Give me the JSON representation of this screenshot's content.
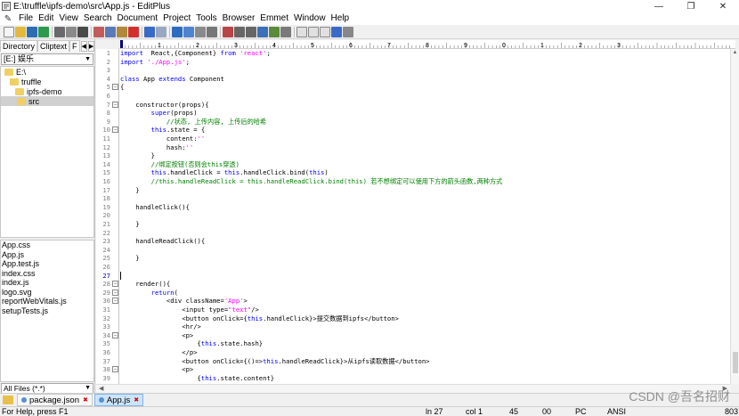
{
  "window": {
    "title": "E:\\truffle\\ipfs-demo\\src\\App.js - EditPlus",
    "controls": {
      "minimize": "—",
      "maximize": "❐",
      "close": "✕"
    }
  },
  "menu": [
    "File",
    "Edit",
    "View",
    "Search",
    "Document",
    "Project",
    "Tools",
    "Browser",
    "Emmet",
    "Window",
    "Help"
  ],
  "left_panel": {
    "tabs": [
      "Directory",
      "Cliptext",
      "F"
    ],
    "drive": "[E:] 娱乐",
    "tree": [
      {
        "label": "E:\\",
        "depth": 0
      },
      {
        "label": "truffle",
        "depth": 1
      },
      {
        "label": "ipfs-demo",
        "depth": 2
      },
      {
        "label": "src",
        "depth": 3,
        "selected": true
      }
    ],
    "files": [
      "App.css",
      "App.js",
      "App.test.js",
      "index.css",
      "index.js",
      "logo.svg",
      "reportWebVitals.js",
      "setupTests.js"
    ],
    "filter": "All Files (*.*)"
  },
  "ruler_labels": [
    "1",
    "2",
    "3",
    "4",
    "5",
    "6",
    "7",
    "8",
    "9",
    "0",
    "1",
    "2",
    "3"
  ],
  "editor": {
    "current_line": 27,
    "lines": [
      {
        "n": "1",
        "code": [
          [
            "kw",
            "import"
          ],
          [
            "",
            "  React,{Component} "
          ],
          [
            "kw",
            "from"
          ],
          [
            "",
            " "
          ],
          [
            "str",
            "'react'"
          ],
          [
            "",
            ";"
          ]
        ]
      },
      {
        "n": "2",
        "code": [
          [
            "kw",
            "import"
          ],
          [
            "",
            " "
          ],
          [
            "str",
            "'./App.js'"
          ],
          [
            "",
            ";"
          ]
        ]
      },
      {
        "n": "3",
        "code": []
      },
      {
        "n": "4",
        "code": [
          [
            "kw",
            "class"
          ],
          [
            "",
            " App "
          ],
          [
            "kw",
            "extends"
          ],
          [
            "",
            " Component"
          ]
        ]
      },
      {
        "n": "5",
        "fold": true,
        "code": [
          [
            "",
            "{"
          ]
        ]
      },
      {
        "n": "6",
        "code": []
      },
      {
        "n": "7",
        "fold": true,
        "code": [
          [
            "",
            "    constructor(props){"
          ]
        ]
      },
      {
        "n": "8",
        "code": [
          [
            "",
            "        "
          ],
          [
            "kw",
            "super"
          ],
          [
            "",
            "(props)"
          ]
        ]
      },
      {
        "n": "9",
        "code": [
          [
            "cmt",
            "            //状态, 上传内容, 上传后的哈希"
          ]
        ]
      },
      {
        "n": "10",
        "fold": true,
        "code": [
          [
            "",
            "        "
          ],
          [
            "kw",
            "this"
          ],
          [
            "",
            ".state = {"
          ]
        ]
      },
      {
        "n": "11",
        "code": [
          [
            "",
            "            content:"
          ],
          [
            "str",
            "''"
          ]
        ]
      },
      {
        "n": "12",
        "code": [
          [
            "",
            "            hash:"
          ],
          [
            "str",
            "''"
          ]
        ]
      },
      {
        "n": "13",
        "code": [
          [
            "",
            "        }"
          ]
        ]
      },
      {
        "n": "14",
        "code": [
          [
            "cmt",
            "        //绑定按钮(否则会this穿透)"
          ]
        ]
      },
      {
        "n": "15",
        "code": [
          [
            "",
            "        "
          ],
          [
            "kw",
            "this"
          ],
          [
            "",
            ".handleClick = "
          ],
          [
            "kw",
            "this"
          ],
          [
            "",
            ".handleClick.bind("
          ],
          [
            "kw",
            "this"
          ],
          [
            "",
            ")"
          ]
        ]
      },
      {
        "n": "16",
        "code": [
          [
            "cmt",
            "        //this.handleReadClick = this.handleReadClick.bind(this) 若不想绑定可以使用下方的箭头函数,两种方式"
          ]
        ]
      },
      {
        "n": "17",
        "code": [
          [
            "",
            "    }"
          ]
        ]
      },
      {
        "n": "18",
        "code": []
      },
      {
        "n": "19",
        "code": [
          [
            "",
            "    handleClick(){"
          ]
        ]
      },
      {
        "n": "20",
        "code": []
      },
      {
        "n": "21",
        "code": [
          [
            "",
            "    }"
          ]
        ]
      },
      {
        "n": "22",
        "code": []
      },
      {
        "n": "23",
        "code": [
          [
            "",
            "    handleReadClick(){"
          ]
        ]
      },
      {
        "n": "24",
        "code": []
      },
      {
        "n": "25",
        "code": [
          [
            "",
            "    }"
          ]
        ]
      },
      {
        "n": "26",
        "code": []
      },
      {
        "n": "27",
        "code": []
      },
      {
        "n": "28",
        "fold": true,
        "code": [
          [
            "",
            "    render(){"
          ]
        ]
      },
      {
        "n": "29",
        "fold": true,
        "code": [
          [
            "",
            "        "
          ],
          [
            "kw",
            "return"
          ],
          [
            "",
            "("
          ]
        ]
      },
      {
        "n": "30",
        "fold": true,
        "code": [
          [
            "",
            "            <div className="
          ],
          [
            "str",
            "'App'"
          ],
          [
            "",
            ">"
          ]
        ]
      },
      {
        "n": "31",
        "code": [
          [
            "",
            "                <input type="
          ],
          [
            "str",
            "\"text\""
          ],
          [
            "",
            "/>"
          ]
        ]
      },
      {
        "n": "32",
        "code": [
          [
            "",
            "                <button onClick={"
          ],
          [
            "kw",
            "this"
          ],
          [
            "",
            ".handleClick}>提交数据到ipfs</button>"
          ]
        ]
      },
      {
        "n": "33",
        "code": [
          [
            "",
            "                <hr/>"
          ]
        ]
      },
      {
        "n": "34",
        "fold": true,
        "code": [
          [
            "",
            "                <p>"
          ]
        ]
      },
      {
        "n": "35",
        "code": [
          [
            "",
            "                    {"
          ],
          [
            "kw",
            "this"
          ],
          [
            "",
            ".state.hash}"
          ]
        ]
      },
      {
        "n": "36",
        "code": [
          [
            "",
            "                </p>"
          ]
        ]
      },
      {
        "n": "37",
        "code": [
          [
            "",
            "                <button onClick={()=>"
          ],
          [
            "kw",
            "this"
          ],
          [
            "",
            ".handleReadClick}>从ipfs读取数据</button>"
          ]
        ]
      },
      {
        "n": "38",
        "fold": true,
        "code": [
          [
            "",
            "                <p>"
          ]
        ]
      },
      {
        "n": "39",
        "code": [
          [
            "",
            "                    {"
          ],
          [
            "kw",
            "this"
          ],
          [
            "",
            ".state.content}"
          ]
        ]
      }
    ]
  },
  "doc_tabs": [
    {
      "label": "package.json",
      "close": "✖",
      "active": false
    },
    {
      "label": "App.js",
      "close": "✖",
      "active": true
    }
  ],
  "status": {
    "help": "For Help, press F1",
    "line": "ln 27",
    "col": "col 1",
    "num1": "45",
    "num2": "00",
    "mode": "PC",
    "encoding": "ANSI",
    "last": "803"
  },
  "watermark": "CSDN @吾名招财",
  "colors": {
    "keyword": "#0000ff",
    "string": "#ff00ff",
    "comment": "#008000"
  }
}
